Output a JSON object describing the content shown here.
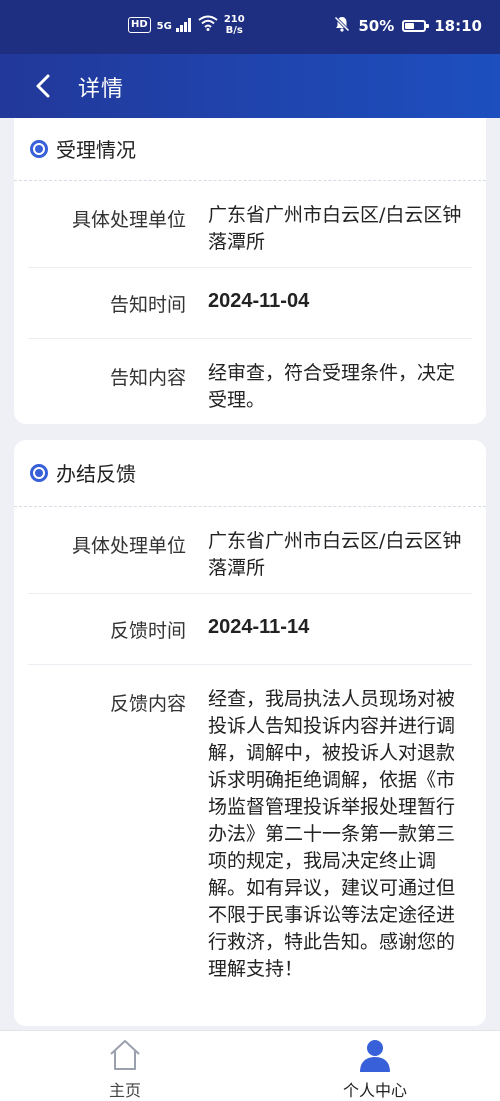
{
  "status_bar": {
    "hd": "HD",
    "signal": "5G",
    "speed_value": "210",
    "speed_unit": "B/s",
    "battery": "50%",
    "battery_level": 0.5,
    "time": "18:10"
  },
  "header": {
    "title": "详情"
  },
  "accept_section": {
    "title": "受理情况",
    "rows": [
      {
        "label": "具体处理单位",
        "value": "广东省广州市白云区/白云区钟落潭所"
      },
      {
        "label": "告知时间",
        "value": "2024-11-04"
      },
      {
        "label": "告知内容",
        "value": "经审查，符合受理条件，决定受理。"
      }
    ]
  },
  "feedback_section": {
    "title": "办结反馈",
    "rows": [
      {
        "label": "具体处理单位",
        "value": "广东省广州市白云区/白云区钟落潭所"
      },
      {
        "label": "反馈时间",
        "value": "2024-11-14"
      },
      {
        "label": "反馈内容",
        "value": "经查，我局执法人员现场对被投诉人告知投诉内容并进行调解，调解中，被投诉人对退款诉求明确拒绝调解，依据《市场监督管理投诉举报处理暂行办法》第二十一条第一款第三项的规定，我局决定终止调解。如有异议，建议可通过但不限于民事诉讼等法定途径进行救济，特此告知。感谢您的理解支持！"
      }
    ]
  },
  "bottom_nav": {
    "home_label": "主页",
    "me_label": "个人中心"
  },
  "colors": {
    "header": "#1e2f82",
    "accent": "#3860d8",
    "background": "#eef0f6"
  }
}
